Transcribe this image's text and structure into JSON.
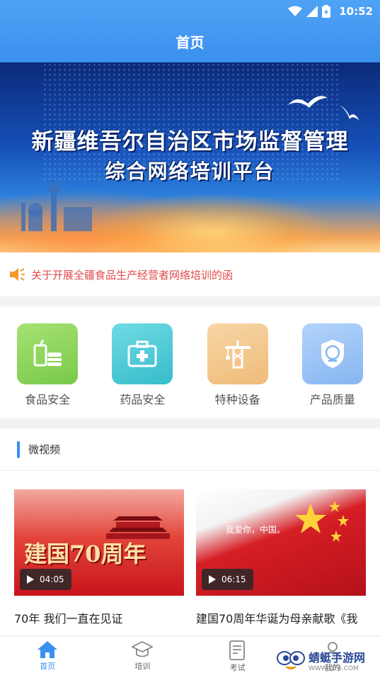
{
  "status": {
    "time": "10:52"
  },
  "header": {
    "title": "首页"
  },
  "banner": {
    "line1": "新疆维吾尔自治区市场监督管理",
    "line2": "综合网络培训平台"
  },
  "notice": {
    "text": "关于开展全疆食品生产经营者网络培训的函"
  },
  "categories": [
    {
      "label": "食品安全",
      "color": "#8fd65c"
    },
    {
      "label": "药品安全",
      "color": "#4ccad8"
    },
    {
      "label": "特种设备",
      "color": "#f2c78c"
    },
    {
      "label": "产品质量",
      "color": "#9ac4f7"
    }
  ],
  "videos": {
    "section_title": "微视频",
    "items": [
      {
        "title": "70年 我们一直在见证",
        "duration": "04:05",
        "thumb_text": "建国70周年"
      },
      {
        "title": "建国70周年华诞为母亲献歌《我",
        "duration": "06:15",
        "thumb_text": "我爱你，中国。"
      }
    ]
  },
  "tabs": [
    {
      "label": "首页",
      "active": true
    },
    {
      "label": "培训",
      "active": false
    },
    {
      "label": "考试",
      "active": false
    },
    {
      "label": "我的",
      "active": false
    }
  ],
  "watermark": {
    "name": "蜻蜓手游网",
    "url": "WWW.QT6.COM"
  },
  "colors": {
    "primary": "#3b8fee",
    "notice": "#e14a4a"
  }
}
